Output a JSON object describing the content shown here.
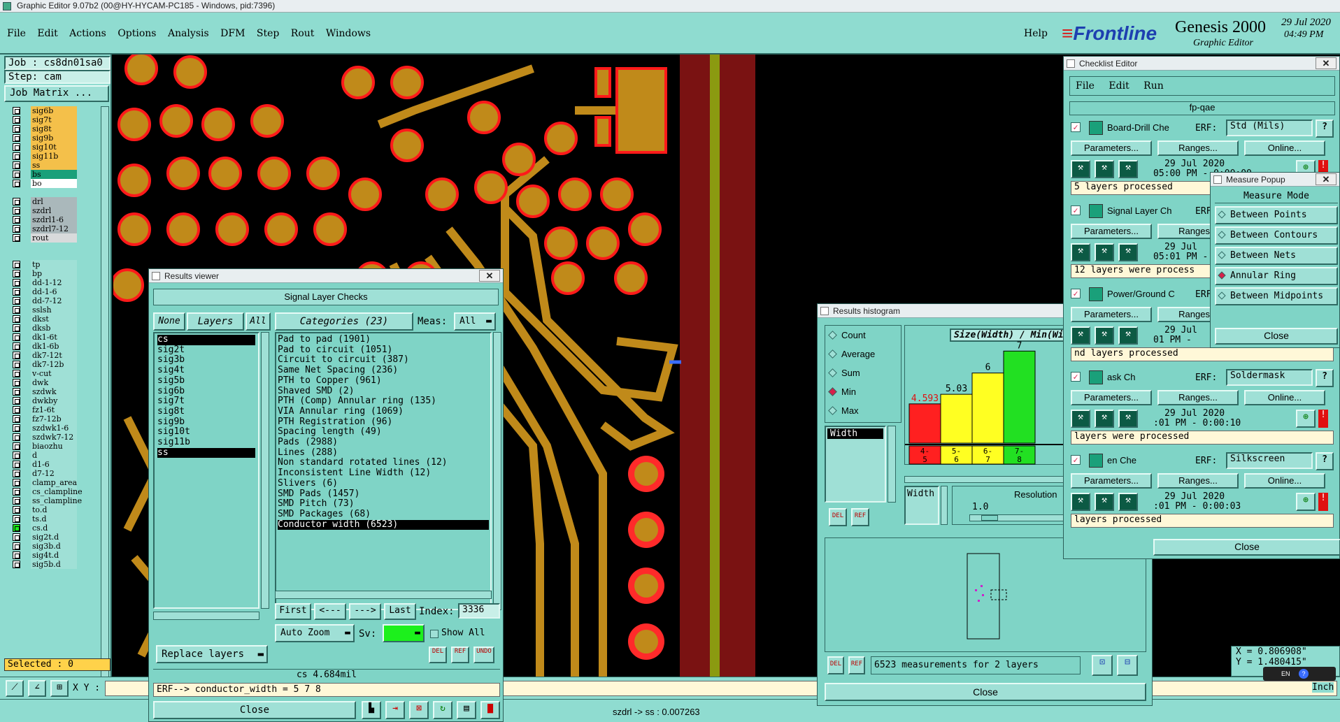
{
  "window_title": "Graphic Editor 9.07b2 (00@HY-HYCAM-PC185 - Windows, pid:7396)",
  "menu": [
    "File",
    "Edit",
    "Actions",
    "Options",
    "Analysis",
    "DFM",
    "Step",
    "Rout",
    "Windows"
  ],
  "help_label": "Help",
  "brand": {
    "logo": "Frontline",
    "product": "Genesis 2000",
    "subtitle": "Graphic Editor",
    "date": "29 Jul 2020",
    "time": "04:49 PM"
  },
  "job": {
    "job_label": "Job : cs8dn01sa0",
    "step_label": "Step: cam",
    "matrix_button": "Job Matrix ..."
  },
  "layers_group1": [
    {
      "name": "sig6b",
      "color": "#f4c04a"
    },
    {
      "name": "sig7t",
      "color": "#f4c04a"
    },
    {
      "name": "sig8t",
      "color": "#f4c04a"
    },
    {
      "name": "sig9b",
      "color": "#f4c04a"
    },
    {
      "name": "sig10t",
      "color": "#f4c04a"
    },
    {
      "name": "sig11b",
      "color": "#f4c04a"
    },
    {
      "name": "ss",
      "color": "#f4c04a"
    },
    {
      "name": "bs",
      "color": "#1aa07a"
    },
    {
      "name": "bo",
      "color": "#ffffff"
    }
  ],
  "layers_group2": [
    {
      "name": "drl",
      "color": "#aab8bb"
    },
    {
      "name": "szdrl",
      "color": "#aab8bb"
    },
    {
      "name": "szdrl1-6",
      "color": "#aab8bb"
    },
    {
      "name": "szdrl7-12",
      "color": "#aab8bb"
    },
    {
      "name": "rout",
      "color": "#d8dadb"
    }
  ],
  "layers_group3": [
    "tp",
    "bp",
    "dd-1-12",
    "dd-1-6",
    "dd-7-12",
    "sslsh",
    "dkst",
    "dksb",
    "dk1-6t",
    "dk1-6b",
    "dk7-12t",
    "dk7-12b",
    "v-cut",
    "dwk",
    "szdwk",
    "dwkby",
    "fz1-6t",
    "fz7-12b",
    "szdwk1-6",
    "szdwk7-12",
    "biaozhu",
    "d",
    "d1-6",
    "d7-12",
    "clamp_area",
    "cs_clampline",
    "ss_clampline",
    "to.d",
    "ts.d",
    "cs.d",
    "sig2t.d",
    "sig3b.d",
    "sig4t.d",
    "sig5b.d"
  ],
  "selected_label": "Selected : 0",
  "xy_label": "X Y :",
  "results_viewer": {
    "title": "Results viewer",
    "header": "Signal Layer Checks",
    "none_btn": "None",
    "layers_btn": "Layers",
    "all_btn": "All",
    "categories_btn": "Categories (23)",
    "meas_label": "Meas:",
    "meas_value": "All",
    "layers": [
      "cs",
      "sig2t",
      "sig3b",
      "sig4t",
      "sig5b",
      "sig6b",
      "sig7t",
      "sig8t",
      "sig9b",
      "sig10t",
      "sig11b",
      "ss"
    ],
    "categories": [
      "Pad to pad (1901)",
      "Pad to circuit (1051)",
      "Circuit to circuit (387)",
      "Same Net Spacing (236)",
      "PTH to Copper (961)",
      "Shaved SMD (2)",
      "PTH (Comp) Annular ring (135)",
      "VIA Annular ring (1069)",
      "PTH Registration (96)",
      "Spacing length (49)",
      "Pads (2988)",
      "Lines (288)",
      "Non standard rotated lines (12)",
      "Inconsistent Line Width (12)",
      "Slivers (6)",
      "SMD Pads (1457)",
      "SMD Pitch (73)",
      "SMD Packages (68)",
      "Conductor width (6523)"
    ],
    "first_btn": "First",
    "prev_btn": "<---",
    "next_btn": "--->",
    "last_btn": "Last",
    "index_label": "Index:",
    "index_value": "3336",
    "zoom_btn": "Auto Zoom",
    "sv_label": "Sv:",
    "show_all": "Show All",
    "replace_btn": "Replace layers",
    "del_btn": "DEL",
    "ref_btn": "REF",
    "undo_btn": "UNDO",
    "status": "cs 4.684mil",
    "erf_line": "ERF--> conductor_width = 5 7 8",
    "close_btn": "Close"
  },
  "status_bar_text": "szdrl -> ss : 0.007263",
  "histogram": {
    "title": "Results histogram",
    "options": [
      "Count",
      "Average",
      "Sum",
      "Min",
      "Max"
    ],
    "selected_option": "Min",
    "measure_item": "Width",
    "chart_title": "Size(Width) / Min(Width)",
    "resolution_label": "Resolution",
    "resolution_value": "1.0",
    "width_tag": "Width",
    "summary": "6523 measurements for 2 layers",
    "close_btn": "Close",
    "del_btn": "DEL",
    "ref_btn": "REF"
  },
  "chart_data": {
    "type": "bar",
    "title": "Size(Width) / Min(Width)",
    "categories": [
      "4-5",
      "5-6",
      "6-7",
      "7-8"
    ],
    "values": [
      4.593,
      5.03,
      6,
      7
    ],
    "value_labels": [
      "4.593",
      "5.03",
      "6",
      "7"
    ],
    "colors": [
      "#ff2020",
      "#ffff22",
      "#ffff22",
      "#22e022"
    ],
    "ylim": [
      0,
      7.5
    ]
  },
  "checklist": {
    "title": "Checklist Editor",
    "menu": [
      "File",
      "Edit",
      "Run"
    ],
    "name": "fp-qae",
    "erf_label": "ERF:",
    "params_btn": "Parameters...",
    "ranges_btn": "Ranges...",
    "online_btn": "Online...",
    "close_btn": "Close",
    "checks": [
      {
        "name": "Board-Drill Che",
        "erf": "Std (Mils)",
        "date": "29 Jul 2020",
        "time": "05:00 PM - 0:00:00",
        "msg": "5 layers processed"
      },
      {
        "name": "Signal Layer Ch",
        "erf": "",
        "date": "29 Jul",
        "time": "05:01 PM -",
        "msg": "12 layers were process"
      },
      {
        "name": "Power/Ground C",
        "erf": "",
        "date": "29 Jul",
        "time": "01 PM -",
        "msg": "nd layers processed"
      },
      {
        "name": "ask Ch",
        "erf": "Soldermask",
        "date": "29 Jul 2020",
        "time": ":01 PM - 0:00:10",
        "msg": " layers were processed"
      },
      {
        "name": "en Che",
        "erf": "Silkscreen",
        "date": "29 Jul 2020",
        "time": ":01 PM - 0:00:03",
        "msg": " layers processed"
      }
    ]
  },
  "measure": {
    "title": "Measure Popup",
    "header": "Measure Mode",
    "modes": [
      "Between Points",
      "Between Contours",
      "Between Nets",
      "Annular Ring",
      "Between Midpoints"
    ],
    "selected": "Annular Ring",
    "close_btn": "Close"
  },
  "coords": {
    "x": "X = 0.806908\"",
    "y": "Y = 1.480415\"",
    "unit": "Inch",
    "lang": "EN"
  }
}
